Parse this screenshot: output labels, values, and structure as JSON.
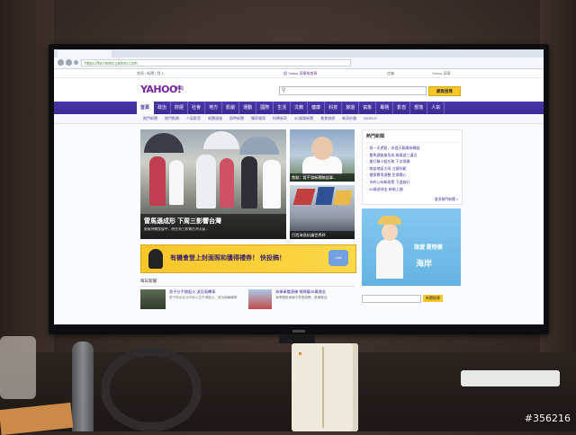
{
  "browser": {
    "url": "https://tw.news.yahoo.com"
  },
  "yahoo_top": {
    "left": "首頁 | 新聞 | 登入",
    "mid": "設 Yahoo 奇摩為首頁",
    "right": "信箱",
    "right2": "Yahoo 奇摩"
  },
  "header": {
    "logo": "YAHOO!",
    "logo_sub": "新聞",
    "search_button": "網頁搜尋"
  },
  "nav": {
    "items": [
      "首頁",
      "政治",
      "財經",
      "社會",
      "地方",
      "影劇",
      "運動",
      "國際",
      "生活",
      "文教",
      "健康",
      "科技",
      "旅遊",
      "氣象",
      "專題",
      "影音",
      "部落",
      "人氣"
    ]
  },
  "subnav": {
    "items": [
      "熱門新聞",
      "熱門點閱",
      "人氣影音",
      "新聞速報",
      "即時新聞",
      "獨家報導",
      "科學新奇",
      "3C娛樂新聞",
      "美食旅遊",
      "新奇妙趣",
      "WORLD"
    ]
  },
  "hero": {
    "title": "雷馬遜成形 下周三影響台灣",
    "subtitle": "颱風持續發展中，將在周三影響台灣天氣..."
  },
  "side_stories": [
    {
      "caption": "焦點：暫不發新聞稿談事..."
    },
    {
      "caption": "巴西海島抗議世界杯"
    }
  ],
  "banner": {
    "text": "有機會登上封面照和獲得禮券！ 快投稿！",
    "badge": "Like"
  },
  "daily": {
    "heading": "每日新聞",
    "items": [
      {
        "title": "男子分手燃起火 波及兩轎車",
        "desc": "男子與女友分手後心生不滿縱火，波及兩輛轎車"
      },
      {
        "title": "海軍軍艦演練 領隊獲15萬賞金",
        "desc": "海軍艦艇演練中表現優異，獲頒獎金"
      }
    ]
  },
  "hot": {
    "heading": "熱門新聞",
    "items": [
      "前一天遊客，本週天氣開始轉變",
      "雷馬遜颱風形成 颱風週三逼近",
      "美打擊小組任務 下次再開",
      "南部地區大雨 注意防範",
      "健保費率調整 民眾關心",
      "市府公布新政策 下週施行",
      "60歲退休金 新制上路"
    ],
    "more": "更多熱門新聞 »"
  },
  "ad": {
    "line1": "旅遊 夏特價",
    "line2": "海岸"
  },
  "search2": {
    "button": "新聞搜尋"
  },
  "watermark": "#356216"
}
